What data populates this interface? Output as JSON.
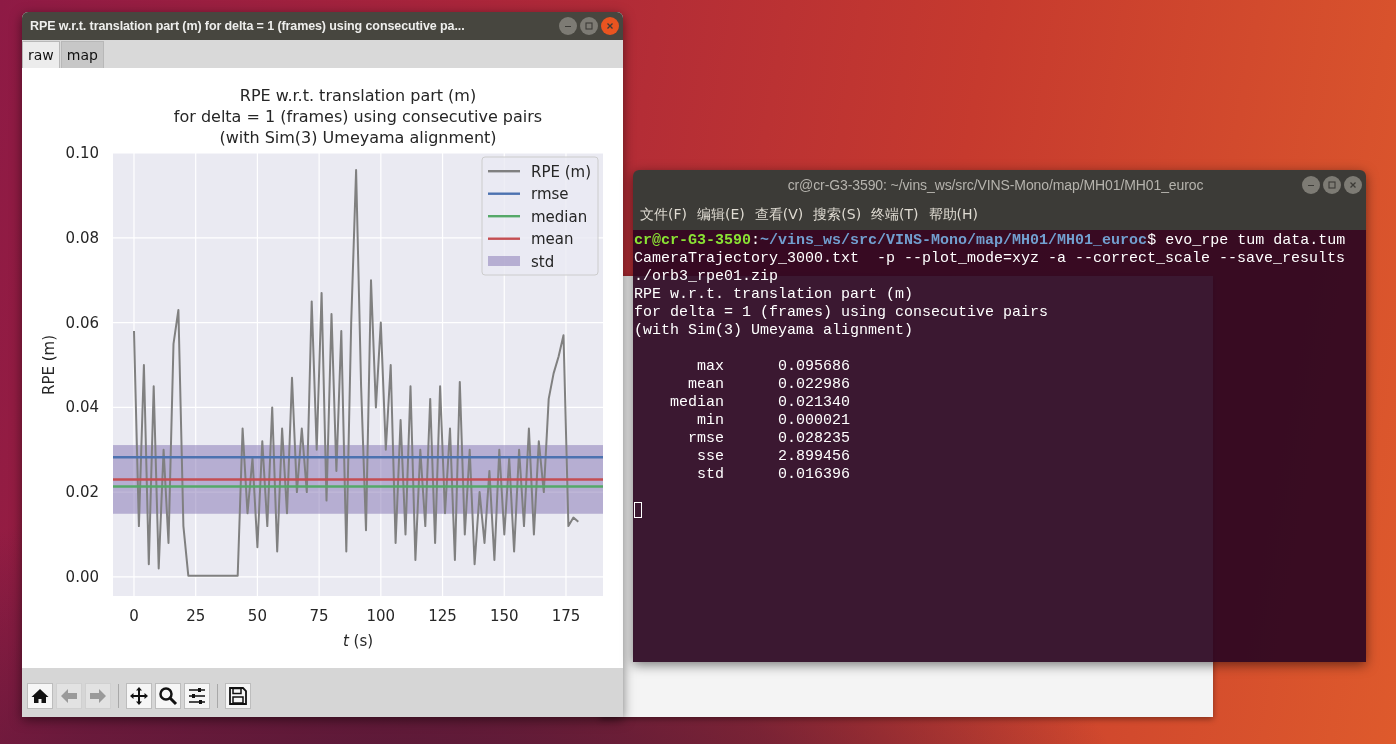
{
  "plot_window": {
    "title": "RPE w.r.t. translation part (m) for delta = 1 (frames) using consecutive pa...",
    "active": true,
    "tabs": [
      {
        "label": "raw",
        "selected": true
      },
      {
        "label": "map",
        "selected": false
      }
    ],
    "chart_data": {
      "type": "line",
      "title": "RPE w.r.t. translation part (m)\nfor delta = 1 (frames) using consecutive pairs\n(with Sim(3) Umeyama alignment)",
      "xlabel": "*t* (s)",
      "ylabel": "RPE (m)",
      "x": [
        0,
        2,
        4,
        6,
        8,
        10,
        12,
        14,
        16,
        18,
        20,
        22,
        24,
        26,
        28,
        30,
        32,
        34,
        36,
        38,
        40,
        42,
        44,
        46,
        48,
        50,
        52,
        54,
        56,
        58,
        60,
        62,
        64,
        66,
        68,
        70,
        72,
        74,
        76,
        78,
        80,
        82,
        84,
        86,
        88,
        90,
        92,
        94,
        96,
        98,
        100,
        102,
        104,
        106,
        108,
        110,
        112,
        114,
        116,
        118,
        120,
        122,
        124,
        126,
        128,
        130,
        132,
        134,
        136,
        138,
        140,
        142,
        144,
        146,
        148,
        150,
        152,
        154,
        156,
        158,
        160,
        162,
        164,
        166,
        168,
        170,
        172,
        174,
        176,
        178,
        180
      ],
      "series": [
        {
          "name": "RPE (m)",
          "color": "#808080",
          "values": [
            0.058,
            0.012,
            0.05,
            0.003,
            0.045,
            0.002,
            0.03,
            0.008,
            0.055,
            0.063,
            0.012,
            0.0003,
            0.0003,
            0.0003,
            0.0003,
            0.0003,
            0.0003,
            0.0003,
            0.0003,
            0.0003,
            0.0003,
            0.0003,
            0.035,
            0.015,
            0.028,
            0.007,
            0.032,
            0.012,
            0.04,
            0.006,
            0.035,
            0.015,
            0.047,
            0.02,
            0.035,
            0.02,
            0.065,
            0.03,
            0.067,
            0.018,
            0.062,
            0.025,
            0.058,
            0.006,
            0.06,
            0.096,
            0.045,
            0.011,
            0.07,
            0.04,
            0.06,
            0.03,
            0.05,
            0.008,
            0.037,
            0.01,
            0.045,
            0.004,
            0.03,
            0.012,
            0.042,
            0.008,
            0.045,
            0.015,
            0.035,
            0.004,
            0.046,
            0.01,
            0.03,
            0.003,
            0.02,
            0.008,
            0.025,
            0.004,
            0.03,
            0.01,
            0.028,
            0.006,
            0.03,
            0.012,
            0.035,
            0.01,
            0.032,
            0.02,
            0.042,
            0.048,
            0.052,
            0.057,
            0.012,
            0.014,
            0.013
          ]
        }
      ],
      "ref_lines": [
        {
          "axis": "y",
          "value": 0.028235,
          "label": "rmse",
          "color": "#4c72b0"
        },
        {
          "axis": "y",
          "value": 0.02134,
          "label": "median",
          "color": "#55a868"
        },
        {
          "axis": "y",
          "value": 0.022986,
          "label": "mean",
          "color": "#c44e52"
        }
      ],
      "bands": [
        {
          "axis": "y",
          "from": 0.0149,
          "to": 0.0311,
          "label": "std",
          "color": "#8172b2"
        }
      ],
      "grid": true,
      "legend": "upper right",
      "xlim": [
        -8.5,
        190
      ],
      "ylim": [
        -0.0045,
        0.1
      ],
      "xticks": [
        0,
        25,
        50,
        75,
        100,
        125,
        150,
        175
      ],
      "yticks": [
        {
          "value": 0,
          "label": "0.00"
        },
        {
          "value": 0.02,
          "label": "0.02"
        },
        {
          "value": 0.04,
          "label": "0.04"
        },
        {
          "value": 0.06,
          "label": "0.06"
        },
        {
          "value": 0.08,
          "label": "0.08"
        },
        {
          "value": 0.1,
          "label": "0.10"
        }
      ]
    },
    "toolbar": [
      {
        "kind": "button",
        "disabled": false
      },
      {
        "kind": "button",
        "disabled": true
      },
      {
        "kind": "button",
        "disabled": true
      },
      {
        "kind": "separator"
      },
      {
        "kind": "button",
        "disabled": false
      },
      {
        "kind": "button",
        "disabled": false
      },
      {
        "kind": "button",
        "disabled": false
      },
      {
        "kind": "separator"
      },
      {
        "kind": "button",
        "disabled": false
      }
    ]
  },
  "terminal": {
    "title": "cr@cr-G3-3590: ~/vins_ws/src/VINS-Mono/map/MH01/MH01_euroc",
    "active": false,
    "menu": [
      "文件(F)",
      "编辑(E)",
      "查看(V)",
      "搜索(S)",
      "终端(T)",
      "帮助(H)"
    ],
    "prompt": {
      "user": "cr@cr-G3-3590",
      "separator": ":",
      "path": "~/vins_ws/src/VINS-Mono/map/MH01/MH01_euroc",
      "symbol": "$",
      "command": "evo_rpe tum data.tum"
    },
    "output": [
      "CameraTrajectory_3000.txt  -p --plot_mode=xyz -a --correct_scale --save_results",
      "./orb3_rpe01.zip",
      "RPE w.r.t. translation part (m)",
      "for delta = 1 (frames) using consecutive pairs",
      "(with Sim(3) Umeyama alignment)"
    ],
    "stats": [
      {
        "name": "max",
        "value": "0.095686"
      },
      {
        "name": "mean",
        "value": "0.022986"
      },
      {
        "name": "median",
        "value": "0.021340"
      },
      {
        "name": "min",
        "value": "0.000021"
      },
      {
        "name": "rmse",
        "value": "0.028235"
      },
      {
        "name": "sse",
        "value": "2.899456"
      },
      {
        "name": "std",
        "value": "0.016396"
      }
    ]
  }
}
